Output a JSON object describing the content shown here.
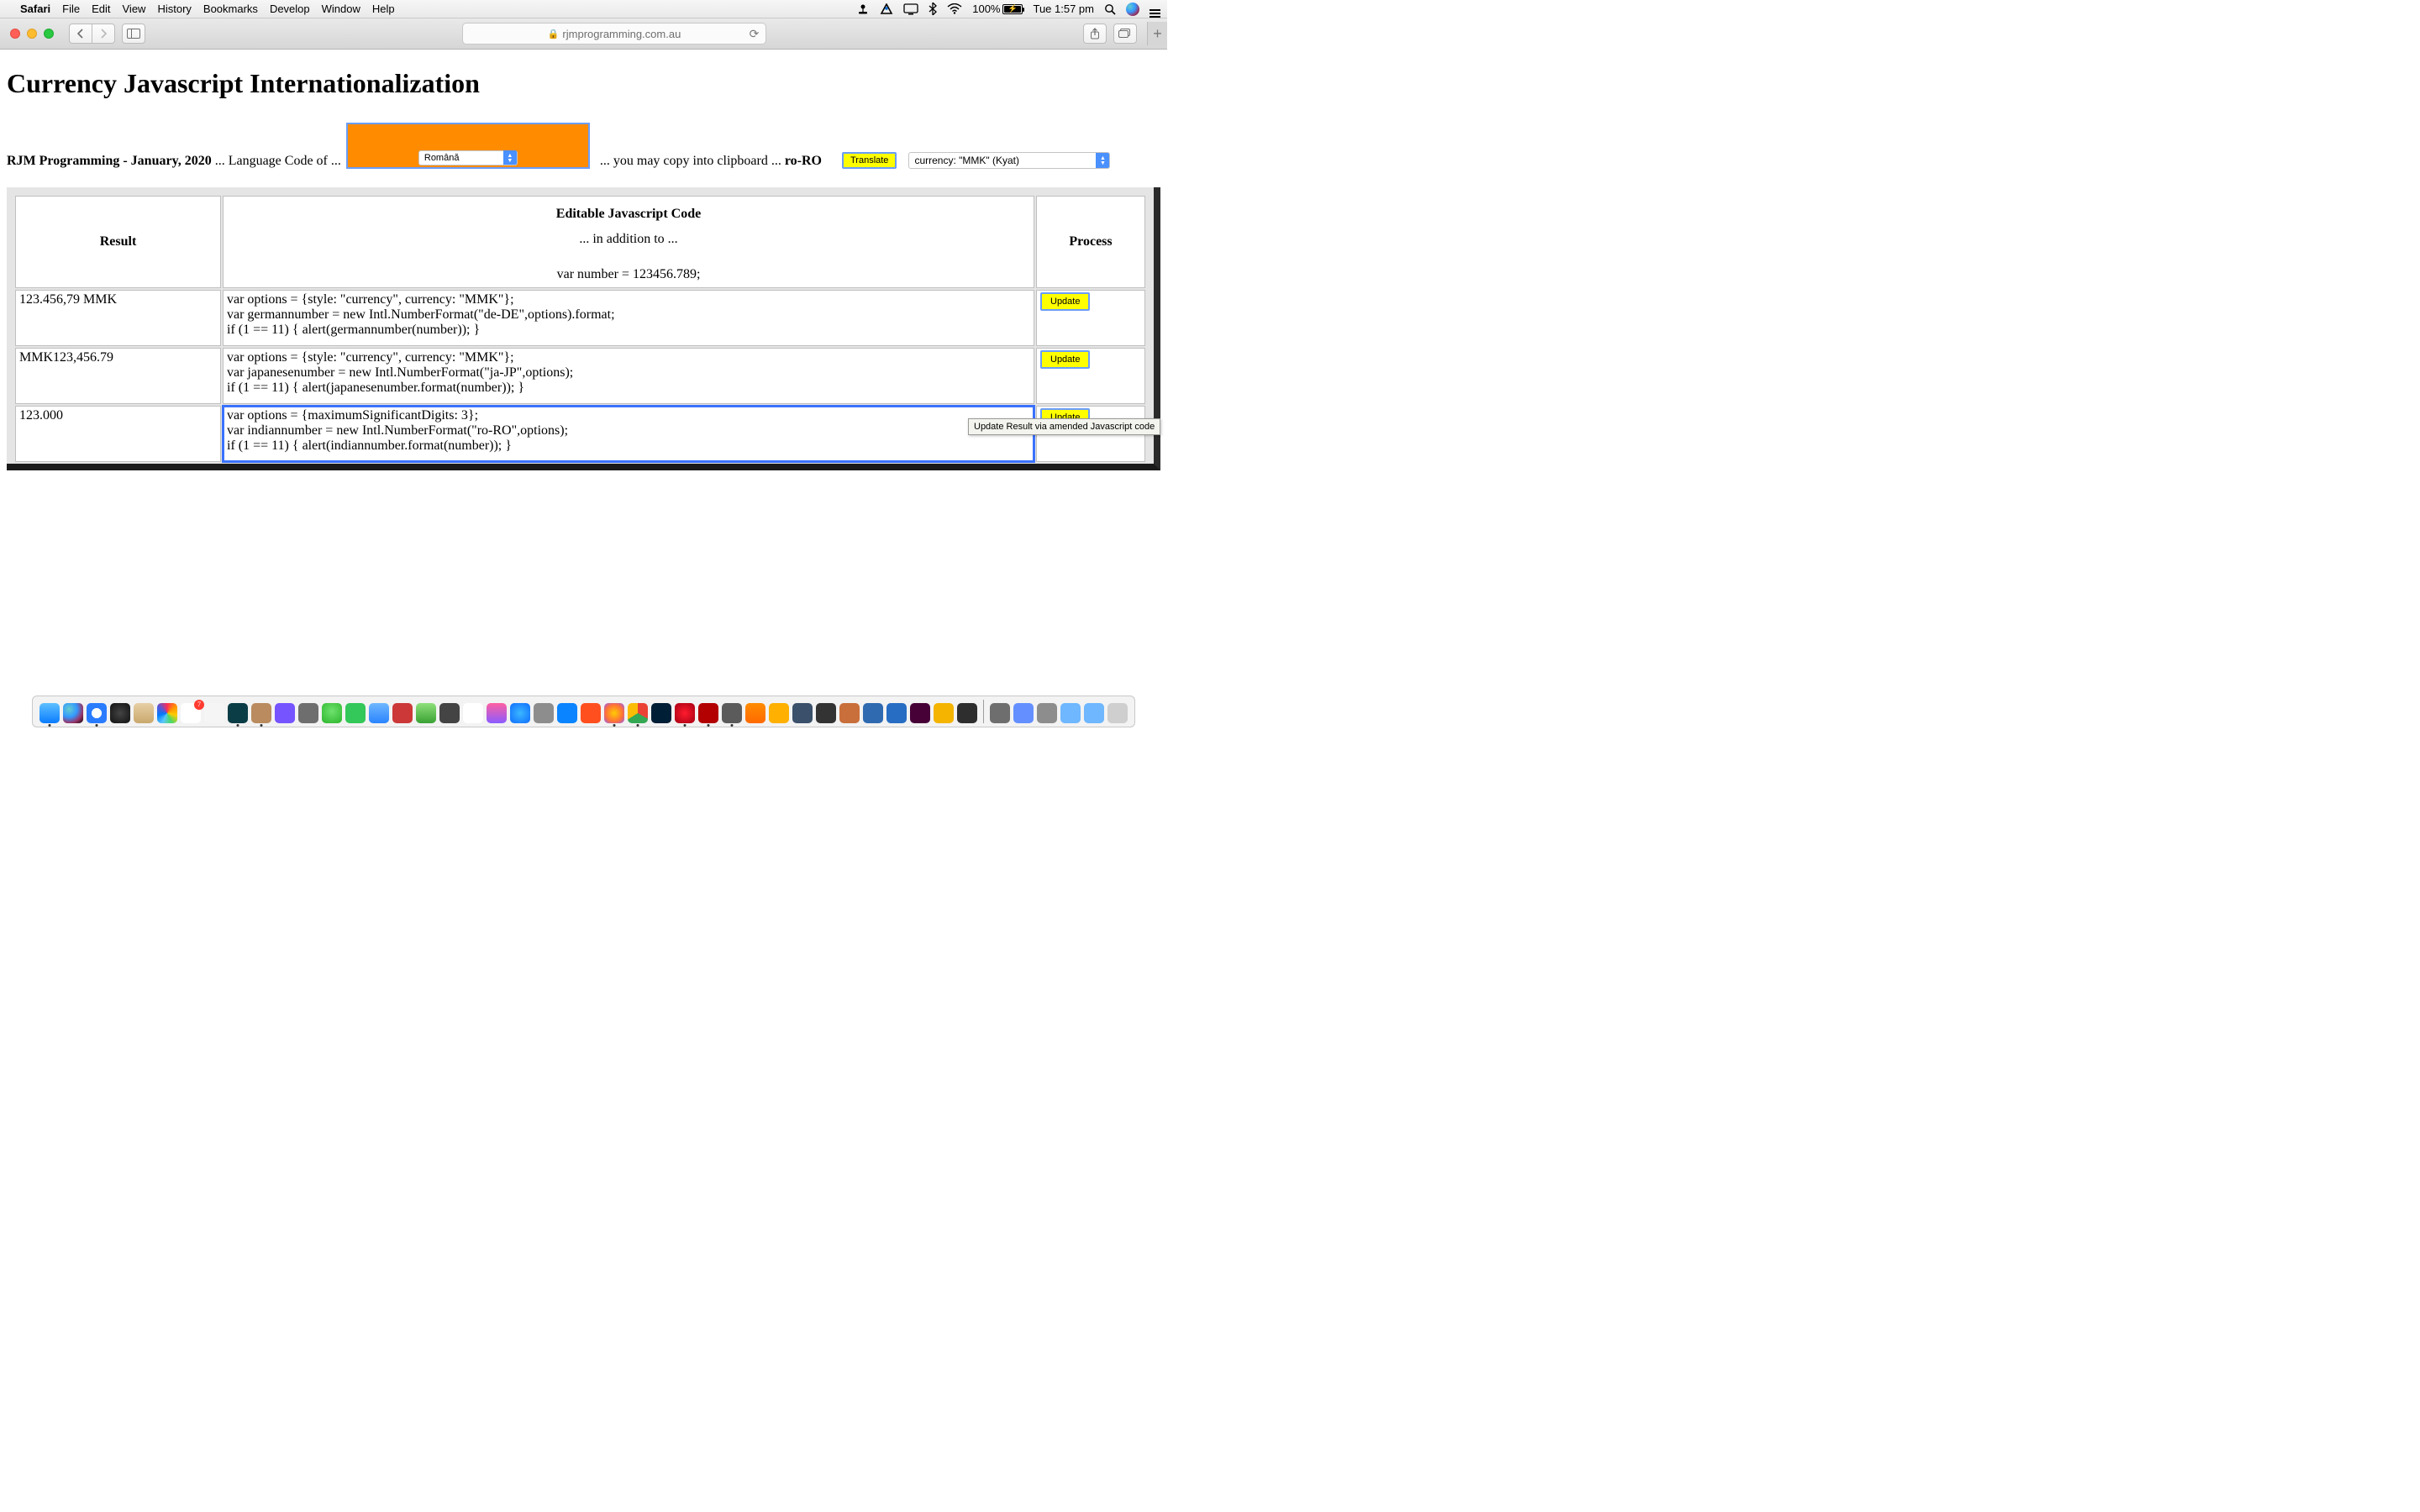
{
  "menubar": {
    "app": "Safari",
    "items": [
      "File",
      "Edit",
      "View",
      "History",
      "Bookmarks",
      "Develop",
      "Window",
      "Help"
    ],
    "battery_pct": "100%",
    "clock": "Tue 1:57 pm"
  },
  "toolbar": {
    "url_host": "rjmprogramming.com.au"
  },
  "page": {
    "title": "Currency Javascript Internationalization",
    "lead_bold": "RJM Programming - January, 2020",
    "lead_rest": " ... Language Code of ...",
    "lang_select_value": "Română",
    "copy_prefix": "... you may copy into clipboard ... ",
    "locale": "ro-RO",
    "translate_btn": "Translate",
    "currency_select_value": "currency: \"MMK\" (Kyat)"
  },
  "table": {
    "headers": {
      "result": "Result",
      "code_title": "Editable Javascript Code",
      "code_sub": "... in addition to ...",
      "code_var": "var number = 123456.789;",
      "process": "Process"
    },
    "rows": [
      {
        "result": "123.456,79 MMK",
        "code": "var options = {style: \"currency\", currency: \"MMK\"};\nvar germannumber = new Intl.NumberFormat(\"de-DE\",options).format;\nif (1 == 11) { alert(germannumber(number)); }",
        "update": "Update"
      },
      {
        "result": "MMK123,456.79",
        "code": "var options = {style: \"currency\", currency: \"MMK\"};\nvar japanesenumber = new Intl.NumberFormat(\"ja-JP\",options);\nif (1 == 11) { alert(japanesenumber.format(number)); }",
        "update": "Update"
      },
      {
        "result": "123.000",
        "code": "var options = {maximumSignificantDigits: 3};\nvar indiannumber = new Intl.NumberFormat(\"ro-RO\",options);\nif (1 == 11) { alert(indiannumber.format(number)); }",
        "update": "Update",
        "selected": true
      }
    ]
  },
  "tooltip": "Update Result via amended Javascript code",
  "dock": {
    "apps_left": [
      {
        "name": "finder",
        "bg": "linear-gradient(#5ec0ff,#0a7cff)",
        "dot": true
      },
      {
        "name": "siri",
        "bg": "radial-gradient(circle at 30% 30%,#6cc,#39f 40%,#936 70%,#000)"
      },
      {
        "name": "safari",
        "bg": "radial-gradient(circle,#fff 35%,#2a7cff 36%)",
        "dot": true
      },
      {
        "name": "dashboard",
        "bg": "radial-gradient(circle,#444,#111)"
      },
      {
        "name": "contacts",
        "bg": "linear-gradient(#e7cfa5,#c9a86c)"
      },
      {
        "name": "photos",
        "bg": "conic-gradient(#ff2d55,#ff9500,#ffcc00,#4cd964,#5ac8fa,#007aff,#5856d6,#ff2d55)"
      },
      {
        "name": "calendar",
        "bg": "linear-gradient(#fff,#fff)",
        "badge": "7"
      },
      {
        "name": "paintbrush",
        "bg": "#f5f5f5"
      },
      {
        "name": "dashlane",
        "bg": "#0b3d47",
        "dot": true
      },
      {
        "name": "gimp",
        "bg": "#b98b5e",
        "dot": true
      },
      {
        "name": "app1",
        "bg": "#7654ff"
      },
      {
        "name": "app2",
        "bg": "#6e6e6e"
      },
      {
        "name": "messages",
        "bg": "radial-gradient(circle at 50% 40%,#6fe26f,#2bb52b)"
      },
      {
        "name": "line",
        "bg": "#34c759"
      },
      {
        "name": "cloud",
        "bg": "linear-gradient(#6fb7ff,#2a84ff)"
      },
      {
        "name": "npm",
        "bg": "#cb3837"
      },
      {
        "name": "numbers",
        "bg": "linear-gradient(#8ee07a,#3aa133)"
      },
      {
        "name": "mamp",
        "bg": "#444"
      },
      {
        "name": "prohibit",
        "bg": "#fff"
      },
      {
        "name": "music",
        "bg": "linear-gradient(#ff5fa2,#8b5cff)"
      },
      {
        "name": "appstore",
        "bg": "radial-gradient(circle,#3ab7ff,#0f6dff)"
      },
      {
        "name": "preferences",
        "bg": "#8d8d8d"
      },
      {
        "name": "xcode",
        "bg": "#0a84ff"
      },
      {
        "name": "brave",
        "bg": "#ff4f1f"
      },
      {
        "name": "firefox",
        "bg": "radial-gradient(circle,#ffcc00,#ff7139 60%,#9059ff)",
        "dot": true
      },
      {
        "name": "chrome",
        "bg": "conic-gradient(#ea4335 0 33%,#34a853 0 66%,#fbbc05 0 100%)",
        "dot": true
      },
      {
        "name": "photoshop",
        "bg": "#001e36"
      },
      {
        "name": "opera",
        "bg": "radial-gradient(circle,#ff1b2d,#a70014)",
        "dot": true
      },
      {
        "name": "filezilla",
        "bg": "#b30000",
        "dot": true
      },
      {
        "name": "mamp2",
        "bg": "#5b5b5b",
        "dot": true
      },
      {
        "name": "vlc",
        "bg": "linear-gradient(#ff8c00,#ff6a00)"
      },
      {
        "name": "audacity",
        "bg": "#ffb000"
      },
      {
        "name": "bird",
        "bg": "#3a506b"
      },
      {
        "name": "cat",
        "bg": "#333"
      },
      {
        "name": "puppet",
        "bg": "#c96f3b"
      },
      {
        "name": "rstudio",
        "bg": "#2f6ab0"
      },
      {
        "name": "r",
        "bg": "#276dc3"
      },
      {
        "name": "xd",
        "bg": "#470137"
      },
      {
        "name": "shell",
        "bg": "#f4b400"
      },
      {
        "name": "flags",
        "bg": "#2e2e2e"
      }
    ],
    "apps_right": [
      {
        "name": "recent1",
        "bg": "#6e6e6e"
      },
      {
        "name": "recent2",
        "bg": "#6490ff"
      },
      {
        "name": "downloads",
        "bg": "#8d8d8d"
      },
      {
        "name": "folder1",
        "bg": "#6fb7ff"
      },
      {
        "name": "folder2",
        "bg": "#6fb7ff"
      },
      {
        "name": "trash",
        "bg": "#cfcfcf"
      }
    ]
  }
}
